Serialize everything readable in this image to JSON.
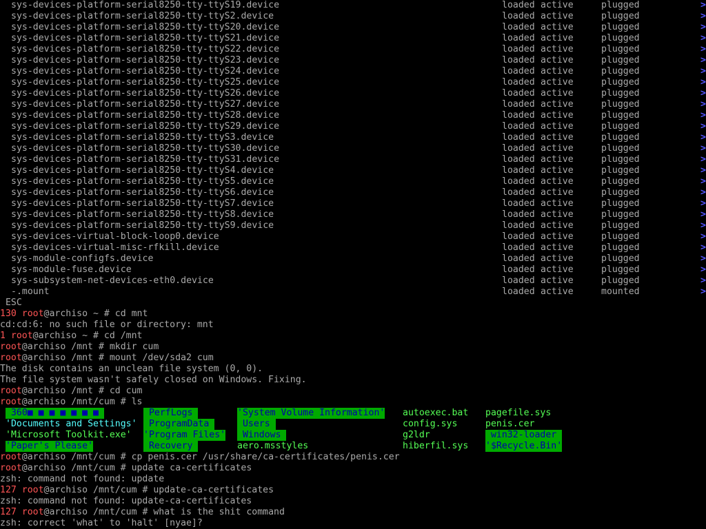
{
  "units": [
    {
      "name": "sys-devices-platform-serial8250-tty-ttyS19.device",
      "load": "loaded",
      "active": "active",
      "sub": "plugged"
    },
    {
      "name": "sys-devices-platform-serial8250-tty-ttyS2.device",
      "load": "loaded",
      "active": "active",
      "sub": "plugged"
    },
    {
      "name": "sys-devices-platform-serial8250-tty-ttyS20.device",
      "load": "loaded",
      "active": "active",
      "sub": "plugged"
    },
    {
      "name": "sys-devices-platform-serial8250-tty-ttyS21.device",
      "load": "loaded",
      "active": "active",
      "sub": "plugged"
    },
    {
      "name": "sys-devices-platform-serial8250-tty-ttyS22.device",
      "load": "loaded",
      "active": "active",
      "sub": "plugged"
    },
    {
      "name": "sys-devices-platform-serial8250-tty-ttyS23.device",
      "load": "loaded",
      "active": "active",
      "sub": "plugged"
    },
    {
      "name": "sys-devices-platform-serial8250-tty-ttyS24.device",
      "load": "loaded",
      "active": "active",
      "sub": "plugged"
    },
    {
      "name": "sys-devices-platform-serial8250-tty-ttyS25.device",
      "load": "loaded",
      "active": "active",
      "sub": "plugged"
    },
    {
      "name": "sys-devices-platform-serial8250-tty-ttyS26.device",
      "load": "loaded",
      "active": "active",
      "sub": "plugged"
    },
    {
      "name": "sys-devices-platform-serial8250-tty-ttyS27.device",
      "load": "loaded",
      "active": "active",
      "sub": "plugged"
    },
    {
      "name": "sys-devices-platform-serial8250-tty-ttyS28.device",
      "load": "loaded",
      "active": "active",
      "sub": "plugged"
    },
    {
      "name": "sys-devices-platform-serial8250-tty-ttyS29.device",
      "load": "loaded",
      "active": "active",
      "sub": "plugged"
    },
    {
      "name": "sys-devices-platform-serial8250-tty-ttyS3.device",
      "load": "loaded",
      "active": "active",
      "sub": "plugged"
    },
    {
      "name": "sys-devices-platform-serial8250-tty-ttyS30.device",
      "load": "loaded",
      "active": "active",
      "sub": "plugged"
    },
    {
      "name": "sys-devices-platform-serial8250-tty-ttyS31.device",
      "load": "loaded",
      "active": "active",
      "sub": "plugged"
    },
    {
      "name": "sys-devices-platform-serial8250-tty-ttyS4.device",
      "load": "loaded",
      "active": "active",
      "sub": "plugged"
    },
    {
      "name": "sys-devices-platform-serial8250-tty-ttyS5.device",
      "load": "loaded",
      "active": "active",
      "sub": "plugged"
    },
    {
      "name": "sys-devices-platform-serial8250-tty-ttyS6.device",
      "load": "loaded",
      "active": "active",
      "sub": "plugged"
    },
    {
      "name": "sys-devices-platform-serial8250-tty-ttyS7.device",
      "load": "loaded",
      "active": "active",
      "sub": "plugged"
    },
    {
      "name": "sys-devices-platform-serial8250-tty-ttyS8.device",
      "load": "loaded",
      "active": "active",
      "sub": "plugged"
    },
    {
      "name": "sys-devices-platform-serial8250-tty-ttyS9.device",
      "load": "loaded",
      "active": "active",
      "sub": "plugged"
    },
    {
      "name": "sys-devices-virtual-block-loop0.device",
      "load": "loaded",
      "active": "active",
      "sub": "plugged"
    },
    {
      "name": "sys-devices-virtual-misc-rfkill.device",
      "load": "loaded",
      "active": "active",
      "sub": "plugged"
    },
    {
      "name": "sys-module-configfs.device",
      "load": "loaded",
      "active": "active",
      "sub": "plugged"
    },
    {
      "name": "sys-module-fuse.device",
      "load": "loaded",
      "active": "active",
      "sub": "plugged"
    },
    {
      "name": "sys-subsystem-net-devices-eth0.device",
      "load": "loaded",
      "active": "active",
      "sub": "plugged"
    },
    {
      "name": "-.mount",
      "load": "loaded",
      "active": "active",
      "sub": "mounted"
    }
  ],
  "scroll_glyph": ">",
  "esc_label": " ESC",
  "session": [
    {
      "status": "130",
      "user": "root",
      "host": "@archiso",
      "path": " ~ ",
      "cmd": "# cd mnt"
    },
    {
      "output": "cd:cd:6: no such file or directory: mnt"
    },
    {
      "status": "1",
      "user": "root",
      "host": "@archiso",
      "path": " ~ ",
      "cmd": "# cd /mnt"
    },
    {
      "status": "",
      "user": "root",
      "host": "@archiso",
      "path": " /mnt ",
      "cmd": "# mkdir cum"
    },
    {
      "status": "",
      "user": "root",
      "host": "@archiso",
      "path": " /mnt ",
      "cmd": "# mount /dev/sda2 cum"
    },
    {
      "output": "The disk contains an unclean file system (0, 0)."
    },
    {
      "output": "The file system wasn't safely closed on Windows. Fixing."
    },
    {
      "status": "",
      "user": "root",
      "host": "@archiso",
      "path": " /mnt ",
      "cmd": "# cd cum"
    },
    {
      "status": "",
      "user": "root",
      "host": "@archiso",
      "path": " /mnt/cum ",
      "cmd": "# ls"
    }
  ],
  "ls_rows": [
    [
      {
        "text": " 360■ ■ ■ ■ ■ ■ ■ ",
        "style": "dir"
      },
      {
        "text": " PerfLogs ",
        "style": "dir"
      },
      {
        "text": "'System Volume Information'",
        "style": "dir"
      },
      {
        "text": "autoexec.bat",
        "style": "file-green"
      },
      {
        "text": "pagefile.sys",
        "style": "file-green"
      }
    ],
    [
      {
        "text": "'Documents and Settings'",
        "style": "cyan"
      },
      {
        "text": " ProgramData ",
        "style": "dir"
      },
      {
        "text": " Users ",
        "style": "dir"
      },
      {
        "text": "config.sys",
        "style": "file-green"
      },
      {
        "text": "penis.cer",
        "style": "file-green"
      }
    ],
    [
      {
        "text": "'Microsoft Toolkit.exe'",
        "style": "file-green"
      },
      {
        "text": "'Program Files'",
        "style": "dir"
      },
      {
        "text": " Windows ",
        "style": "dir"
      },
      {
        "text": "g2ldr",
        "style": "file-green"
      },
      {
        "text": " win32-loader ",
        "style": "dir"
      }
    ],
    [
      {
        "text": "'Paper's Please'",
        "style": "dir"
      },
      {
        "text": " Recovery ",
        "style": "dir"
      },
      {
        "text": "aero.msstyles",
        "style": "file-green"
      },
      {
        "text": "hiberfil.sys",
        "style": "file-green"
      },
      {
        "text": "'$Recycle.Bin'",
        "style": "dir"
      }
    ]
  ],
  "session2": [
    {
      "status": "",
      "user": "root",
      "host": "@archiso",
      "path": " /mnt/cum ",
      "cmd": "# cp penis.cer /usr/share/ca-certificates/penis.cer"
    },
    {
      "status": "",
      "user": "root",
      "host": "@archiso",
      "path": " /mnt/cum ",
      "cmd": "# update ca-certificates"
    },
    {
      "output": "zsh: command not found: update"
    },
    {
      "status": "127",
      "user": "root",
      "host": "@archiso",
      "path": " /mnt/cum ",
      "cmd": "# update-ca-certificates"
    },
    {
      "output": "zsh: command not found: update-ca-certificates"
    },
    {
      "status": "127",
      "user": "root",
      "host": "@archiso",
      "path": " /mnt/cum ",
      "cmd": "# what is the shit command"
    },
    {
      "output": "zsh: correct 'what' to 'halt' [nyae]?"
    }
  ],
  "colors": {
    "bg": "#000000",
    "fg": "#aaaaaa",
    "prompt_red": "#ff5555",
    "dir_bg": "#00aa00",
    "dir_fg": "#0000aa",
    "exec_green": "#55ff55",
    "scroll_blue": "#5555ff"
  }
}
